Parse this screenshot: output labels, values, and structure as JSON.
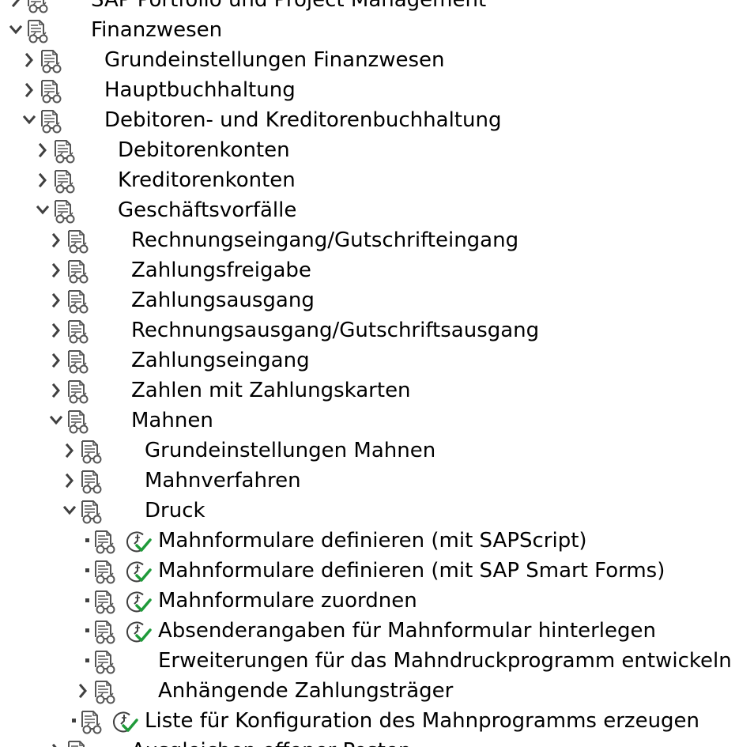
{
  "tree": {
    "nodes": [
      {
        "label": "SAP Portfolio und Project Management",
        "level": 0,
        "state": "collapsed",
        "activity": false
      },
      {
        "label": "Finanzwesen",
        "level": 0,
        "state": "expanded",
        "activity": false
      },
      {
        "label": "Grundeinstellungen Finanzwesen",
        "level": 1,
        "state": "collapsed",
        "activity": false
      },
      {
        "label": "Hauptbuchhaltung",
        "level": 1,
        "state": "collapsed",
        "activity": false
      },
      {
        "label": "Debitoren- und Kreditorenbuchhaltung",
        "level": 1,
        "state": "expanded",
        "activity": false
      },
      {
        "label": "Debitorenkonten",
        "level": 2,
        "state": "collapsed",
        "activity": false
      },
      {
        "label": "Kreditorenkonten",
        "level": 2,
        "state": "collapsed",
        "activity": false
      },
      {
        "label": "Geschäftsvorfälle",
        "level": 2,
        "state": "expanded",
        "activity": false
      },
      {
        "label": "Rechnungseingang/Gutschrifteingang",
        "level": 3,
        "state": "collapsed",
        "activity": false
      },
      {
        "label": "Zahlungsfreigabe",
        "level": 3,
        "state": "collapsed",
        "activity": false
      },
      {
        "label": "Zahlungsausgang",
        "level": 3,
        "state": "collapsed",
        "activity": false
      },
      {
        "label": "Rechnungsausgang/Gutschriftsausgang",
        "level": 3,
        "state": "collapsed",
        "activity": false
      },
      {
        "label": "Zahlungseingang",
        "level": 3,
        "state": "collapsed",
        "activity": false
      },
      {
        "label": "Zahlen mit Zahlungskarten",
        "level": 3,
        "state": "collapsed",
        "activity": false
      },
      {
        "label": "Mahnen",
        "level": 3,
        "state": "expanded",
        "activity": false
      },
      {
        "label": "Grundeinstellungen Mahnen",
        "level": 4,
        "state": "collapsed",
        "activity": false
      },
      {
        "label": "Mahnverfahren",
        "level": 4,
        "state": "collapsed",
        "activity": false
      },
      {
        "label": "Druck",
        "level": 4,
        "state": "expanded",
        "activity": false
      },
      {
        "label": "Mahnformulare definieren (mit SAPScript)",
        "level": 5,
        "state": "leaf",
        "activity": true
      },
      {
        "label": "Mahnformulare definieren (mit SAP Smart Forms)",
        "level": 5,
        "state": "leaf",
        "activity": true
      },
      {
        "label": "Mahnformulare zuordnen",
        "level": 5,
        "state": "leaf",
        "activity": true
      },
      {
        "label": "Absenderangaben für Mahnformular hinterlegen",
        "level": 5,
        "state": "leaf",
        "activity": true
      },
      {
        "label": "Erweiterungen für das Mahndruckprogramm entwickeln",
        "level": 5,
        "state": "leaf",
        "activity": false
      },
      {
        "label": "Anhängende Zahlungsträger",
        "level": 5,
        "state": "collapsed",
        "activity": false
      },
      {
        "label": "Liste für Konfiguration des Mahnprogramms erzeugen",
        "level": 4,
        "state": "leaf",
        "activity": true
      },
      {
        "label": "Ausgleichen offener Posten",
        "level": 3,
        "state": "collapsed",
        "activity": false
      }
    ]
  },
  "icons": {
    "doc_icon": "documentation-glasses-icon",
    "activity_icon": "execute-clock-check-icon",
    "expanded_icon": "chevron-down-icon",
    "collapsed_icon": "chevron-right-icon",
    "leaf_icon": "leaf-bullet-icon"
  },
  "colors": {
    "text": "#000000",
    "icon_gray": "#555555",
    "check_green": "#1f9a3a",
    "background": "#ffffff"
  }
}
